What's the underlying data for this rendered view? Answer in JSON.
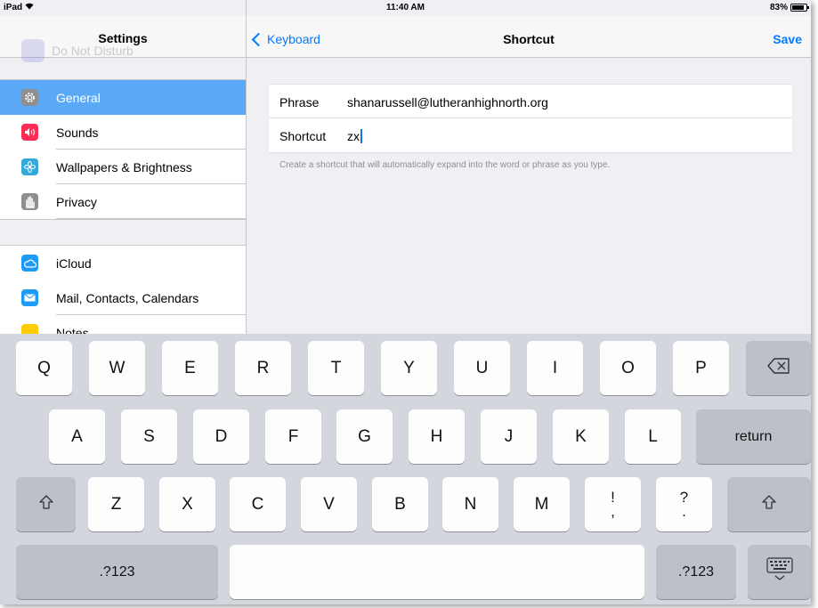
{
  "status_bar": {
    "device": "iPad",
    "wifi_icon": "wifi-icon",
    "time": "11:40 AM",
    "battery": "83%"
  },
  "sidebar": {
    "ghost_text": "Do Not Disturb",
    "title": "Settings",
    "items": [
      {
        "label": "General",
        "icon": "gear-icon",
        "color": "#8e8e93",
        "selected": true
      },
      {
        "label": "Sounds",
        "icon": "speaker-icon",
        "color": "#ff2d55"
      },
      {
        "label": "Wallpapers & Brightness",
        "icon": "flower-icon",
        "color": "#34aadc"
      },
      {
        "label": "Privacy",
        "icon": "hand-icon",
        "color": "#8e8e93"
      },
      {
        "label": "iCloud",
        "icon": "cloud-icon",
        "color": "#1d9bf6"
      },
      {
        "label": "Mail, Contacts, Calendars",
        "icon": "envelope-icon",
        "color": "#1d9bf6"
      },
      {
        "label": "Notes",
        "icon": "notes-icon",
        "color": "#ffcc00"
      }
    ]
  },
  "nav": {
    "back_label": "Keyboard",
    "title": "Shortcut",
    "save_label": "Save"
  },
  "form": {
    "phrase_label": "Phrase",
    "phrase_value": "shanarussell@lutheranhighnorth.org",
    "shortcut_label": "Shortcut",
    "shortcut_value": "zx",
    "footnote": "Create a shortcut that will automatically expand into the word or phrase as you type."
  },
  "keyboard": {
    "row1": [
      "Q",
      "W",
      "E",
      "R",
      "T",
      "Y",
      "U",
      "I",
      "O",
      "P"
    ],
    "row2": [
      "A",
      "S",
      "D",
      "F",
      "G",
      "H",
      "J",
      "K",
      "L"
    ],
    "row3": [
      "Z",
      "X",
      "C",
      "V",
      "B",
      "N",
      "M"
    ],
    "excl": [
      "!",
      ","
    ],
    "quest": [
      "?",
      "."
    ],
    "return_label": "return",
    "numbers_label": ".?123",
    "backspace_icon": "backspace-icon",
    "shift_icon": "shift-icon",
    "hide_keyboard_icon": "hide-keyboard-icon"
  }
}
